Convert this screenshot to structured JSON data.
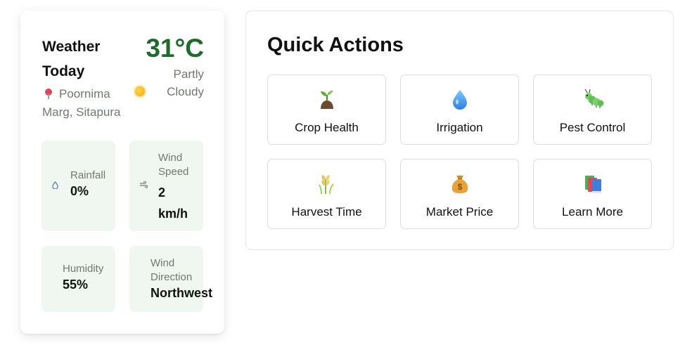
{
  "weather": {
    "title": "Weather Today",
    "temperature": "31°C",
    "condition": "Partly Cloudy",
    "condition_icon": "sun-icon",
    "location": "Poornima Marg, Sitapura",
    "location_icon": "pin-icon",
    "stats": {
      "rainfall": {
        "label": "Rainfall",
        "value": "0%",
        "icon": "droplet-icon"
      },
      "wind_speed": {
        "label": "Wind Speed",
        "value": "2 km/h",
        "icon": "wind-icon"
      },
      "humidity": {
        "label": "Humidity",
        "value": "55%"
      },
      "wind_direction": {
        "label": "Wind Direction",
        "value": "Northwest"
      }
    },
    "colors": {
      "temperature": "#1e6b2a",
      "tile_bg": "#f0f6f0"
    }
  },
  "quick_actions": {
    "title": "Quick Actions",
    "items": [
      {
        "label": "Crop Health",
        "icon": "seedling-icon"
      },
      {
        "label": "Irrigation",
        "icon": "water-drop-icon"
      },
      {
        "label": "Pest Control",
        "icon": "bug-icon"
      },
      {
        "label": "Harvest Time",
        "icon": "wheat-icon"
      },
      {
        "label": "Market Price",
        "icon": "money-bag-icon"
      },
      {
        "label": "Learn More",
        "icon": "books-icon"
      }
    ]
  }
}
